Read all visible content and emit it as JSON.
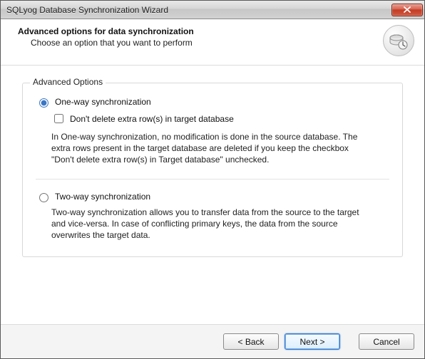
{
  "window": {
    "title": "SQLyog Database Synchronization Wizard"
  },
  "header": {
    "title": "Advanced options for data synchronization",
    "subtitle": "Choose an option that you want to perform"
  },
  "group": {
    "label": "Advanced Options"
  },
  "option1": {
    "label": "One-way synchronization",
    "checkbox": "Don't delete extra row(s) in target database",
    "desc": "In One-way synchronization, no modification is done in the source database. The extra rows present in the target database are deleted if you keep the checkbox \"Don't delete extra row(s) in Target database\" unchecked."
  },
  "option2": {
    "label": "Two-way synchronization",
    "desc": "Two-way synchronization allows you to transfer data from the source to the target and vice-versa. In case of conflicting primary keys, the data from the source overwrites the target data."
  },
  "buttons": {
    "back": "< Back",
    "next": "Next >",
    "cancel": "Cancel"
  }
}
